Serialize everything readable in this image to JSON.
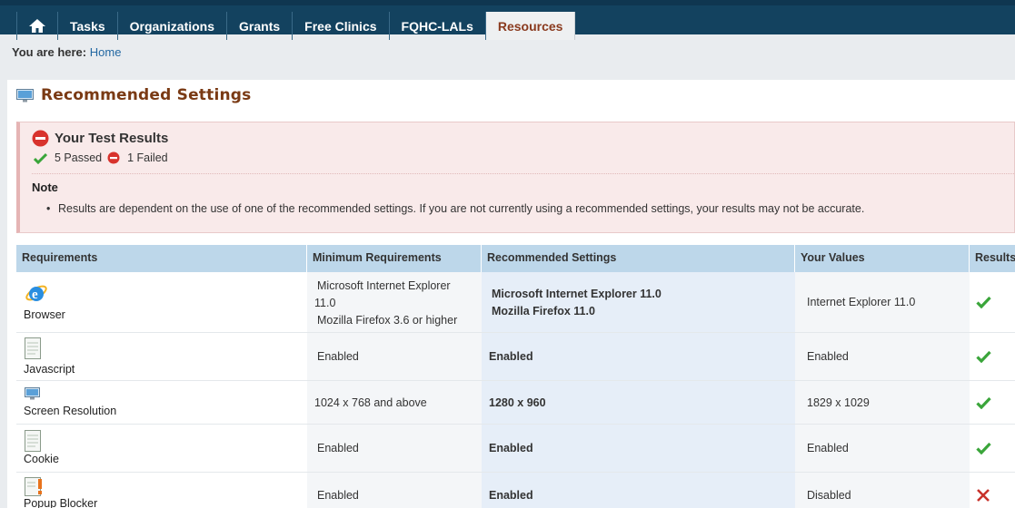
{
  "nav": {
    "items": [
      "Tasks",
      "Organizations",
      "Grants",
      "Free Clinics",
      "FQHC-LALs",
      "Resources"
    ],
    "active": "Resources"
  },
  "breadcrumb": {
    "prefix": "You are here:",
    "link": "Home"
  },
  "page": {
    "title": "Recommended Settings"
  },
  "results": {
    "title": "Your Test Results",
    "passed": "5 Passed",
    "failed": "1 Failed",
    "note_title": "Note",
    "note_text": "Results are dependent on the use of one of the recommended settings. If you are not currently using a recommended settings, your results may not be accurate."
  },
  "table": {
    "headers": [
      "Requirements",
      "Minimum Requirements",
      "Recommended Settings",
      "Your Values",
      "Results"
    ],
    "rows": [
      {
        "name": "Browser",
        "icon": "ie-browser-icon",
        "min_line1": "Microsoft Internet Explorer",
        "min_line2": "11.0",
        "min_line3": "Mozilla Firefox 3.6 or higher",
        "rec_line1": "Microsoft Internet Explorer 11.0",
        "rec_line2": "Mozilla Firefox 11.0",
        "value": "Internet Explorer 11.0",
        "result": "pass"
      },
      {
        "name": "Javascript",
        "icon": "document-icon",
        "min": "Enabled",
        "rec": "Enabled",
        "value": "Enabled",
        "result": "pass"
      },
      {
        "name": "Screen Resolution",
        "icon": "monitor-icon",
        "min": "1024 x 768 and above",
        "rec": "1280 x 960",
        "value": "1829 x 1029",
        "result": "pass"
      },
      {
        "name": "Cookie",
        "icon": "document-icon",
        "min": "Enabled",
        "rec": "Enabled",
        "value": "Enabled",
        "result": "pass"
      },
      {
        "name": "Popup Blocker",
        "icon": "popup-warning-icon",
        "min": "Enabled",
        "rec": "Enabled",
        "value": "Disabled",
        "result": "fail"
      }
    ]
  },
  "colors": {
    "nav_bg": "#13425f",
    "title": "#7a3a14",
    "pass": "#3aa53a",
    "fail": "#c8322b",
    "link": "#2368a2"
  }
}
